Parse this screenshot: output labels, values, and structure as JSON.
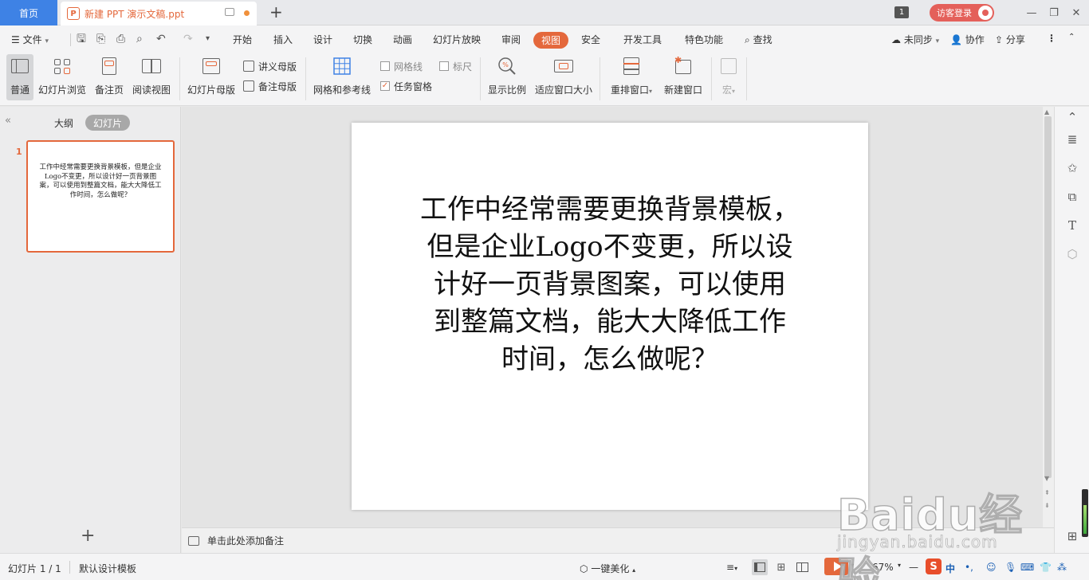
{
  "titlebar": {
    "home_tab": "首页",
    "doc_tab_title": "新建 PPT 演示文稿.ppt",
    "page_count": "1",
    "login_label": "访客登录"
  },
  "menubar": {
    "file_label": "文件",
    "tabs": [
      "开始",
      "插入",
      "设计",
      "切换",
      "动画",
      "幻灯片放映",
      "审阅",
      "视图",
      "安全",
      "开发工具",
      "特色功能"
    ],
    "active_tab": "视图",
    "search_label": "查找",
    "sync_label": "未同步",
    "collab_label": "协作",
    "share_label": "分享"
  },
  "ribbon": {
    "normal": "普通",
    "slide_sorter": "幻灯片浏览",
    "notes_page": "备注页",
    "reading_view": "阅读视图",
    "slide_master": "幻灯片母版",
    "handout_master": "讲义母版",
    "notes_master": "备注母版",
    "grid_guides": "网格和参考线",
    "gridlines": "网格线",
    "ruler": "标尺",
    "task_pane": "任务窗格",
    "zoom": "显示比例",
    "fit_window": "适应窗口大小",
    "arrange_window": "重排窗口",
    "new_window": "新建窗口",
    "macro": "宏",
    "gridlines_checked": false,
    "ruler_checked": false,
    "task_pane_checked": true
  },
  "leftpanel": {
    "outline_tab": "大纲",
    "slides_tab": "幻灯片",
    "slide_number": "1",
    "thumb_text": "工作中经常需要更换背景模板，但是企业Logo不变更，所以设计好一页背景图案，可以使用到整篇文档，能大大降低工作时间，怎么做呢？"
  },
  "slide": {
    "lines": [
      "工作中经常需要更换背景模板，",
      "但是企业Logo不变更，所以设",
      "计好一页背景图案，可以使用",
      "到整篇文档，能大大降低工作",
      "时间，怎么做呢？"
    ]
  },
  "notes": {
    "placeholder": "单击此处添加备注"
  },
  "statusbar": {
    "slide_info": "幻灯片 1 / 1",
    "template": "默认设计模板",
    "beautify": "一键美化",
    "zoom": "67%",
    "ime": "中"
  },
  "watermark": {
    "main": "Baidu经验",
    "sub": "jingyan.baidu.com"
  },
  "colors": {
    "accent": "#e4683c",
    "home_tab": "#3e82e5",
    "login": "#e4605a"
  }
}
